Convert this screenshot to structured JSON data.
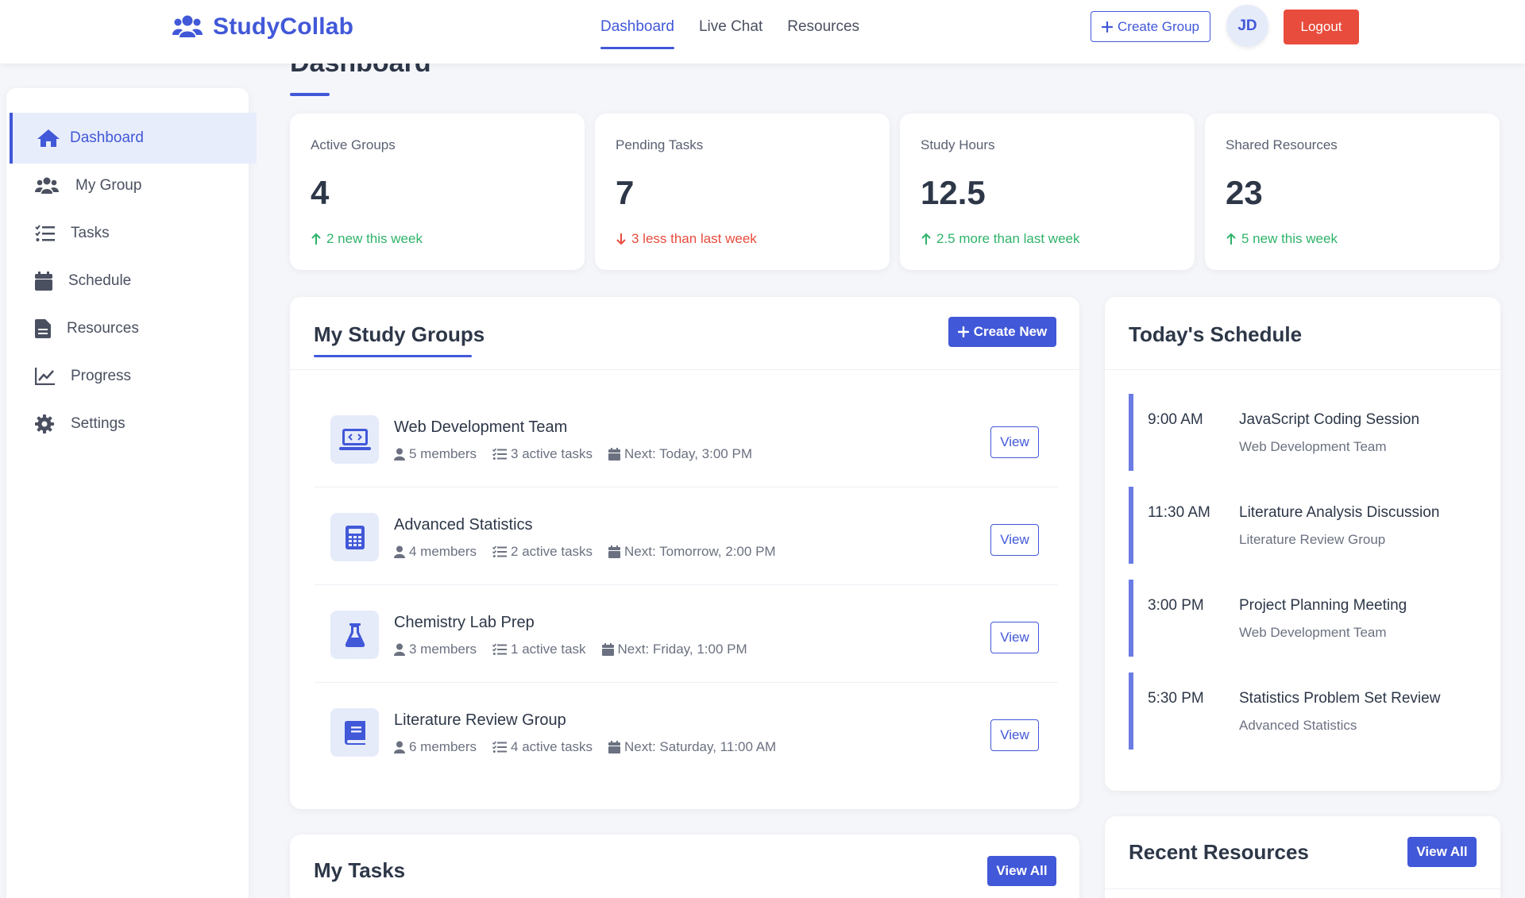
{
  "brand": {
    "name": "StudyCollab",
    "icon": "users-icon",
    "color": "#4158d8"
  },
  "topnav": [
    {
      "label": "Dashboard",
      "active": true
    },
    {
      "label": "Live Chat",
      "active": false
    },
    {
      "label": "Resources",
      "active": false
    }
  ],
  "header": {
    "create_group_label": "Create Group",
    "avatar_initials": "JD",
    "logout_label": "Logout"
  },
  "sidebar": {
    "items": [
      {
        "label": "Dashboard",
        "icon": "home-icon",
        "active": true
      },
      {
        "label": "My Group",
        "icon": "users-icon",
        "active": false
      },
      {
        "label": "Tasks",
        "icon": "list-check-icon",
        "active": false
      },
      {
        "label": "Schedule",
        "icon": "calendar-icon",
        "active": false
      },
      {
        "label": "Resources",
        "icon": "file-icon",
        "active": false
      },
      {
        "label": "Progress",
        "icon": "chart-line-icon",
        "active": false
      },
      {
        "label": "Settings",
        "icon": "gear-icon",
        "active": false
      }
    ]
  },
  "page": {
    "title": "Dashboard"
  },
  "stats": [
    {
      "label": "Active Groups",
      "value": "4",
      "trend": "2 new this week",
      "direction": "up"
    },
    {
      "label": "Pending Tasks",
      "value": "7",
      "trend": "3 less than last week",
      "direction": "down"
    },
    {
      "label": "Study Hours",
      "value": "12.5",
      "trend": "2.5 more than last week",
      "direction": "up"
    },
    {
      "label": "Shared Resources",
      "value": "23",
      "trend": "5 new this week",
      "direction": "up"
    }
  ],
  "groups_panel": {
    "title": "My Study Groups",
    "create_label": "Create New",
    "view_label": "View",
    "groups": [
      {
        "name": "Web Development Team",
        "icon": "laptop-code-icon",
        "members": "5 members",
        "tasks": "3 active tasks",
        "next": "Next: Today, 3:00 PM"
      },
      {
        "name": "Advanced Statistics",
        "icon": "calculator-icon",
        "members": "4 members",
        "tasks": "2 active tasks",
        "next": "Next: Tomorrow, 2:00 PM"
      },
      {
        "name": "Chemistry Lab Prep",
        "icon": "flask-icon",
        "members": "3 members",
        "tasks": "1 active task",
        "next": "Next: Friday, 1:00 PM"
      },
      {
        "name": "Literature Review Group",
        "icon": "book-icon",
        "members": "6 members",
        "tasks": "4 active tasks",
        "next": "Next: Saturday, 11:00 AM"
      }
    ]
  },
  "schedule_panel": {
    "title": "Today's Schedule",
    "items": [
      {
        "time": "9:00 AM",
        "title": "JavaScript Coding Session",
        "group": "Web Development Team"
      },
      {
        "time": "11:30 AM",
        "title": "Literature Analysis Discussion",
        "group": "Literature Review Group"
      },
      {
        "time": "3:00 PM",
        "title": "Project Planning Meeting",
        "group": "Web Development Team"
      },
      {
        "time": "5:30 PM",
        "title": "Statistics Problem Set Review",
        "group": "Advanced Statistics"
      }
    ]
  },
  "tasks_panel": {
    "title": "My Tasks",
    "view_all_label": "View All"
  },
  "resources_panel": {
    "title": "Recent Resources",
    "view_all_label": "View All"
  },
  "colors": {
    "accent": "#4158d8",
    "danger": "#e84c3d",
    "success": "#2fb36a"
  }
}
